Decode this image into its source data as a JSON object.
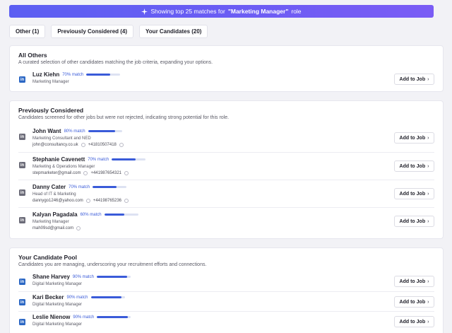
{
  "banner": {
    "prefix": "Showing top 25 matches for",
    "role": "\"Marketing Manager\"",
    "suffix": "role"
  },
  "tabs": [
    "Other (1)",
    "Previously Considered (4)",
    "Your Candidates (20)"
  ],
  "add_label": "Add to Job",
  "colors": {
    "accent": "#5b5ef2",
    "match": "#3a5bd9",
    "linkedin": "#2b67c4"
  },
  "sections": {
    "others": {
      "title": "All Others",
      "desc": "A curated selection of other candidates matching the job criteria, expanding your options.",
      "candidates": [
        {
          "name": "Luz Kiehn",
          "match": "70% match",
          "match_value": 0.7,
          "title": "Marketing Manager"
        }
      ]
    },
    "previous": {
      "title": "Previously Considered",
      "desc": "Candidates screened for other jobs but were not rejected, indicating strong potential for this role.",
      "candidates": [
        {
          "name": "John Want",
          "match": "80% match",
          "match_value": 0.8,
          "title": "Marketing Consultant and NED",
          "email": "john@consultancy.co.uk",
          "phone": "+41810507418"
        },
        {
          "name": "Stephanie Cavenett",
          "match": "70% match",
          "match_value": 0.7,
          "title": "Marketing & Operations Manager",
          "email": "stepmarketer@gmail.com",
          "phone": "+441987654321"
        },
        {
          "name": "Danny Cater",
          "match": "70% match",
          "match_value": 0.7,
          "title": "Head of IT & Marketing",
          "email": "dannygo1246@yahoo.com",
          "phone": "+44198765236"
        },
        {
          "name": "Kalyan Pagadala",
          "match": "60% match",
          "match_value": 0.6,
          "title": "Marketing Manager",
          "email": "mah09sd@gmail.com",
          "phone": ""
        }
      ]
    },
    "pool": {
      "title": "Your Candidate Pool",
      "desc": "Candidates you are managing, underscoring your recruitment efforts and connections.",
      "candidates": [
        {
          "name": "Shane Harvey",
          "match": "90% match",
          "match_value": 0.9,
          "title": "Digital Marketing Manager"
        },
        {
          "name": "Kari Becker",
          "match": "90% match",
          "match_value": 0.9,
          "title": "Digital Marketing Manager"
        },
        {
          "name": "Leslie Nienow",
          "match": "90% match",
          "match_value": 0.9,
          "title": "Digital Marketing Manager"
        }
      ]
    }
  }
}
